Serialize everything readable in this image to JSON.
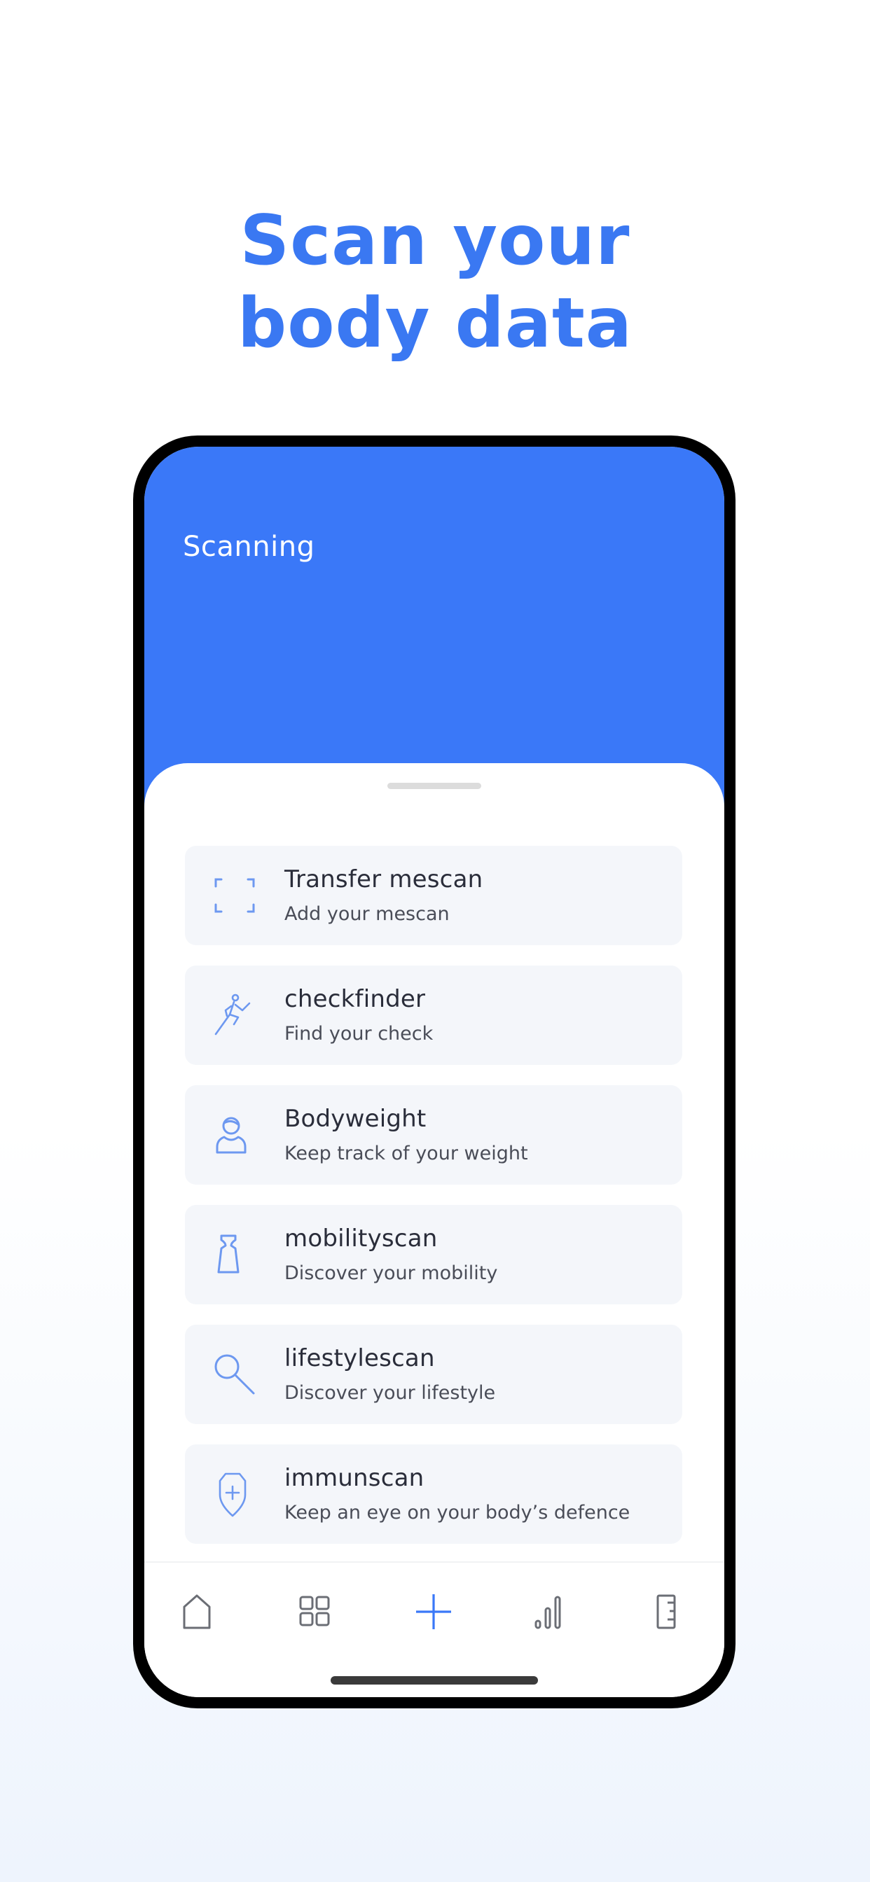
{
  "headline": {
    "line1": "Scan your",
    "line2": "body data"
  },
  "app": {
    "header_title": "Scanning",
    "accent_color": "#3a78f8",
    "items": [
      {
        "icon": "scan-frame-icon",
        "title": "Transfer mescan",
        "subtitle": "Add your mescan"
      },
      {
        "icon": "running-person-icon",
        "title": "checkfinder",
        "subtitle": "Find your check"
      },
      {
        "icon": "person-icon",
        "title": "Bodyweight",
        "subtitle": "Keep track of your weight"
      },
      {
        "icon": "weight-icon",
        "title": "mobilityscan",
        "subtitle": "Discover your mobility"
      },
      {
        "icon": "magnifier-icon",
        "title": "lifestylescan",
        "subtitle": "Discover your lifestyle"
      },
      {
        "icon": "shield-plus-icon",
        "title": "immunscan",
        "subtitle": "Keep an eye on your body’s defence"
      }
    ],
    "tabbar": {
      "tabs": [
        {
          "name": "home",
          "icon": "home-icon",
          "active": false
        },
        {
          "name": "dashboard",
          "icon": "grid-icon",
          "active": false
        },
        {
          "name": "add",
          "icon": "plus-icon",
          "active": true
        },
        {
          "name": "statistics",
          "icon": "bar-chart-icon",
          "active": false
        },
        {
          "name": "measure",
          "icon": "ruler-icon",
          "active": false
        }
      ]
    }
  }
}
